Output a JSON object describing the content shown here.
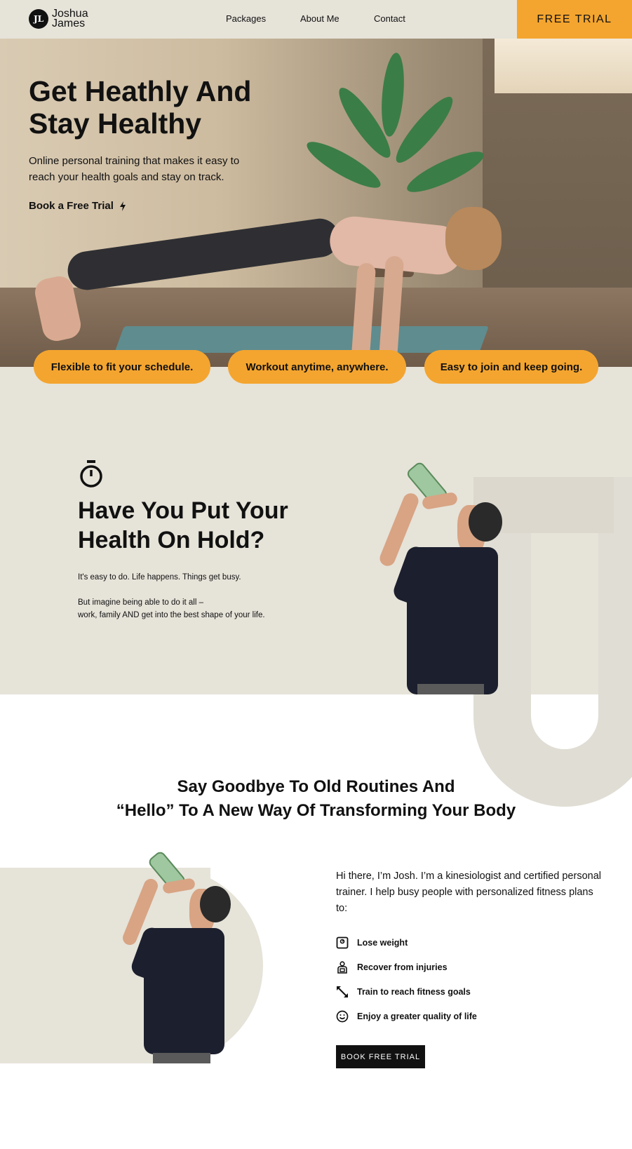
{
  "nav": {
    "logo_mark": "JL",
    "logo_line1": "Joshua",
    "logo_line2": "James",
    "links": [
      "Packages",
      "About Me",
      "Contact"
    ],
    "cta": "FREE TRIAL"
  },
  "hero": {
    "title_line1": "Get Heathly And",
    "title_line2": "Stay Healthy",
    "subtitle": "Online personal training that makes it easy to reach your health goals and stay on track.",
    "link": "Book a Free Trial"
  },
  "pills": [
    "Flexible to fit your schedule.",
    "Workout anytime, anywhere.",
    "Easy to join and keep going."
  ],
  "section2": {
    "title_line1": "Have You Put Your",
    "title_line2": "Health On Hold?",
    "p1": "It's easy to do. Life happens. Things get busy.",
    "p2_line1": "But imagine being able to do it all –",
    "p2_line2": "work, family AND get into the best shape of your life."
  },
  "section3": {
    "title_line1": "Say Goodbye To Old Routines And",
    "title_line2": "“Hello” To A New Way Of Transforming Your Body",
    "intro": "Hi there, I’m Josh. I’m a kinesiologist and certified personal trainer.  I help busy people with personalized fitness plans to:",
    "features": [
      {
        "icon": "scale-icon",
        "label": "Lose weight"
      },
      {
        "icon": "recovery-icon",
        "label": "Recover from injuries"
      },
      {
        "icon": "expand-arrows-icon",
        "label": "Train to reach fitness goals"
      },
      {
        "icon": "smile-icon",
        "label": "Enjoy a greater quality of life"
      }
    ],
    "button": "BOOK FREE TRIAL"
  },
  "colors": {
    "accent": "#f4a52f",
    "beige": "#e6e3d9",
    "dark": "#111111"
  }
}
